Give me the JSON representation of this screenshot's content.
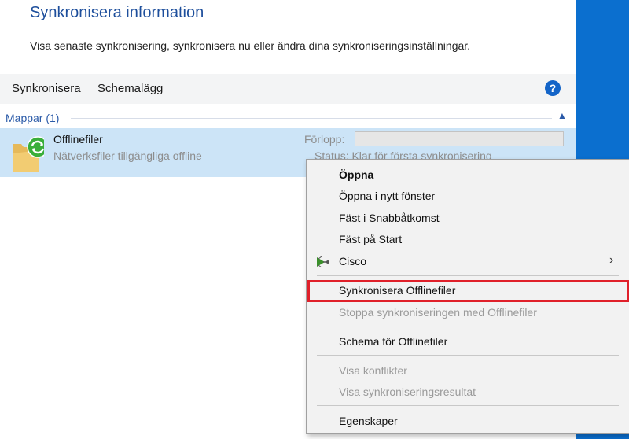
{
  "header": {
    "title": "Synkronisera information",
    "description": "Visa senaste synkronisering, synkronisera nu eller ändra dina synkroniseringsinställningar."
  },
  "toolbar": {
    "sync_label": "Synkronisera",
    "schedule_label": "Schemalägg",
    "help_icon": "help-icon",
    "help_glyph": "?"
  },
  "group": {
    "label": "Mappar (1)",
    "collapse_icon": "chevron-up-icon"
  },
  "item": {
    "name": "Offlinefiler",
    "description": "Nätverksfiler tillgängliga offline",
    "progress_label": "Förlopp:",
    "progress_value": 0,
    "status": "Status: Klar för första synkronisering",
    "icon": "sync-folder-icon"
  },
  "context_menu": {
    "items": [
      {
        "label": "Öppna",
        "bold": true,
        "enabled": true
      },
      {
        "label": "Öppna i nytt fönster",
        "enabled": true
      },
      {
        "label": "Fäst i Snabbåtkomst",
        "enabled": true
      },
      {
        "label": "Fäst på Start",
        "enabled": true
      },
      {
        "label": "Cisco",
        "enabled": true,
        "submenu": true,
        "icon": "cisco-icon"
      },
      {
        "label": "Synkronisera Offlinefiler",
        "enabled": true,
        "highlighted": true
      },
      {
        "label": "Stoppa synkroniseringen med Offlinefiler",
        "enabled": false
      },
      {
        "label": "Schema för Offlinefiler",
        "enabled": true
      },
      {
        "label": "Visa konflikter",
        "enabled": false
      },
      {
        "label": "Visa synkroniseringsresultat",
        "enabled": false
      },
      {
        "label": "Egenskaper",
        "enabled": true
      }
    ],
    "highlight_color": "#e0202a"
  },
  "colors": {
    "accent_blue": "#0b6fcf",
    "title_blue": "#1e4f9c",
    "selection": "#cce4f7"
  }
}
